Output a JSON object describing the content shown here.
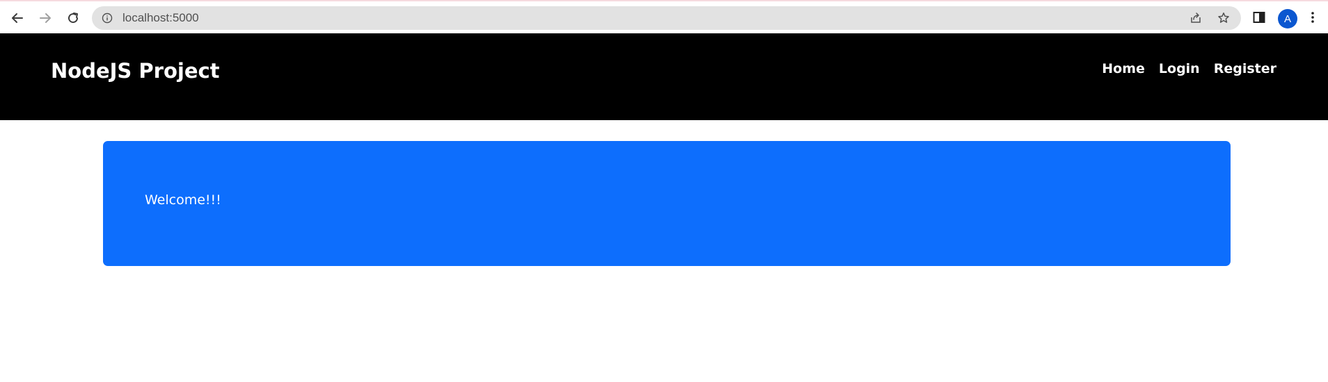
{
  "browser": {
    "url": "localhost:5000",
    "avatar_letter": "A",
    "icons": [
      "back-arrow-icon",
      "forward-arrow-icon",
      "reload-icon",
      "info-icon",
      "share-icon",
      "star-icon",
      "side-panel-icon",
      "kebab-menu-icon"
    ]
  },
  "navbar": {
    "brand": "NodeJS Project",
    "links": [
      "Home",
      "Login",
      "Register"
    ],
    "background": "#000000"
  },
  "main": {
    "welcome_text": "Welcome!!!",
    "card_color": "#0d6efd"
  }
}
